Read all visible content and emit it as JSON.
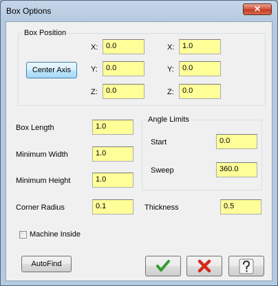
{
  "window": {
    "title": "Box Options",
    "close_glyph": "✕"
  },
  "box_position": {
    "group_label": "Box Position",
    "center_axis_label": "Center Axis",
    "left": {
      "x_label": "X:",
      "x": "0.0",
      "y_label": "Y:",
      "y": "0.0",
      "z_label": "Z:",
      "z": "0.0"
    },
    "right": {
      "x_label": "X:",
      "x": "1.0",
      "y_label": "Y:",
      "y": "0.0",
      "z_label": "Z:",
      "z": "0.0"
    }
  },
  "dimensions": {
    "box_length_label": "Box Length",
    "box_length": "1.0",
    "min_width_label": "Minimum Width",
    "min_width": "1.0",
    "min_height_label": "Minimum Height",
    "min_height": "1.0",
    "corner_radius_label": "Corner Radius",
    "corner_radius": "0.1",
    "thickness_label": "Thickness",
    "thickness": "0.5"
  },
  "angle_limits": {
    "group_label": "Angle Limits",
    "start_label": "Start",
    "start": "0.0",
    "sweep_label": "Sweep",
    "sweep": "360.0"
  },
  "machine_inside": {
    "label": "Machine Inside",
    "checked": false
  },
  "buttons": {
    "autofind_label": "AutoFind",
    "ok_icon": "green-checkmark-icon",
    "cancel_icon": "red-x-icon",
    "help_icon": "question-mark-icon"
  },
  "colors": {
    "field_bg": "#ffff99",
    "ok_green": "#2e9e2e",
    "cancel_red": "#d42a1a"
  }
}
